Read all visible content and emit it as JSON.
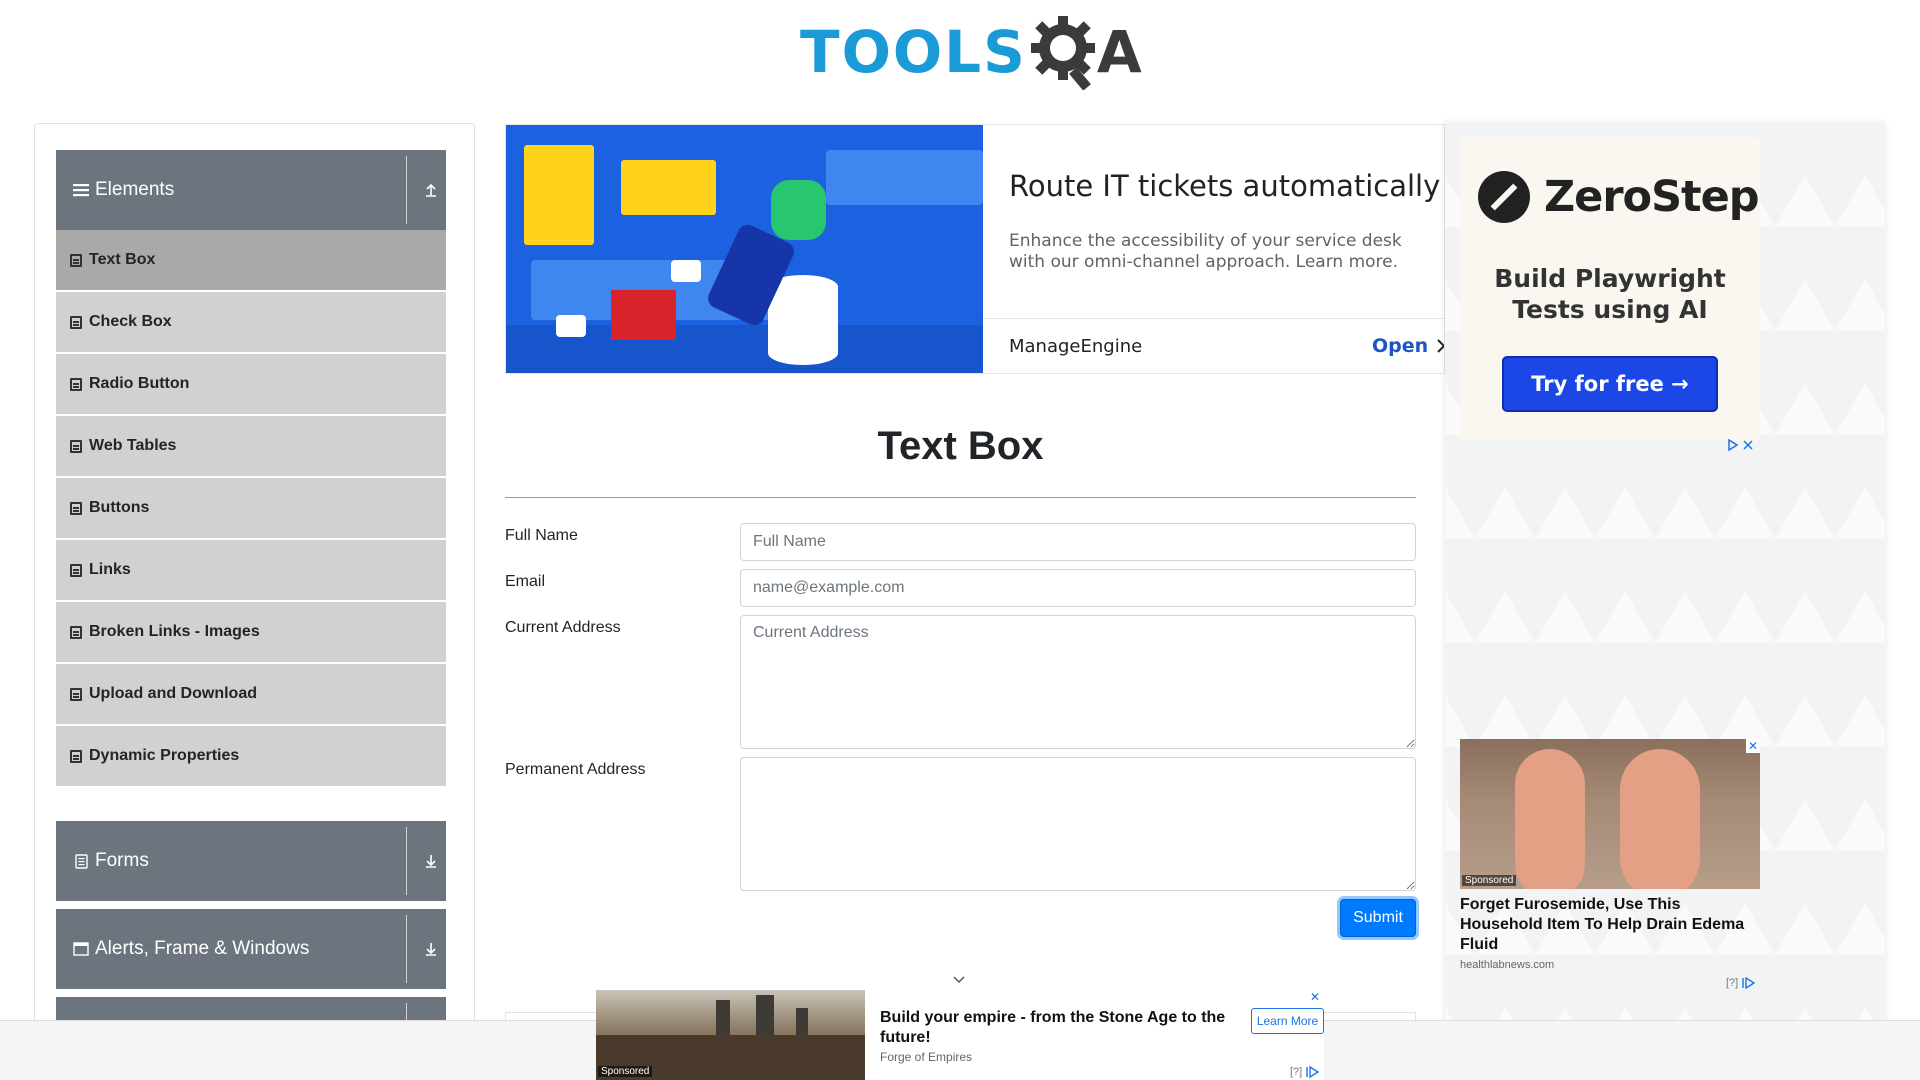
{
  "header": {
    "logo_tools": "TOOLS",
    "logo_qa": "QA"
  },
  "sidebar": {
    "groups": [
      {
        "label": "Elements",
        "icon": "hamburger-icon",
        "expanded": true
      },
      {
        "label": "Forms",
        "icon": "document-icon",
        "expanded": false
      },
      {
        "label": "Alerts, Frame & Windows",
        "icon": "window-icon",
        "expanded": false
      }
    ],
    "elements_items": [
      {
        "label": "Text Box",
        "active": true
      },
      {
        "label": "Check Box",
        "active": false
      },
      {
        "label": "Radio Button",
        "active": false
      },
      {
        "label": "Web Tables",
        "active": false
      },
      {
        "label": "Buttons",
        "active": false
      },
      {
        "label": "Links",
        "active": false
      },
      {
        "label": "Broken Links - Images",
        "active": false
      },
      {
        "label": "Upload and Download",
        "active": false
      },
      {
        "label": "Dynamic Properties",
        "active": false
      }
    ]
  },
  "top_ad": {
    "title": "Route IT tickets automatically",
    "description": "Enhance the accessibility of your service desk with our omni-channel approach. Learn more.",
    "brand": "ManageEngine",
    "cta": "Open"
  },
  "main": {
    "title": "Text Box",
    "form": {
      "full_name_label": "Full Name",
      "full_name_placeholder": "Full Name",
      "email_label": "Email",
      "email_placeholder": "name@example.com",
      "current_address_label": "Current Address",
      "current_address_placeholder": "Current Address",
      "permanent_address_label": "Permanent Address",
      "permanent_address_placeholder": "",
      "submit_label": "Submit"
    }
  },
  "right_ads": {
    "zerostep": {
      "brand": "ZeroStep",
      "tagline": "Build Playwright Tests using AI",
      "button": "Try for free →"
    },
    "edema": {
      "sponsored": "Sponsored",
      "headline": "Forget Furosemide, Use This Household Item To Help Drain Edema Fluid",
      "source": "healthlabnews.com",
      "adchoice": "[?]"
    }
  },
  "bottom_ad": {
    "sponsored": "Sponsored",
    "title": "Build your empire - from the Stone Age to the future!",
    "source": "Forge of Empires",
    "cta": "Learn More",
    "adchoice": "[?]"
  },
  "colors": {
    "accent": "#007bff",
    "sidebar_header": "#6c757d",
    "menu_item": "#d1d1d1",
    "menu_item_active": "#a9a9a9",
    "logo_blue": "#1a9bd7"
  }
}
